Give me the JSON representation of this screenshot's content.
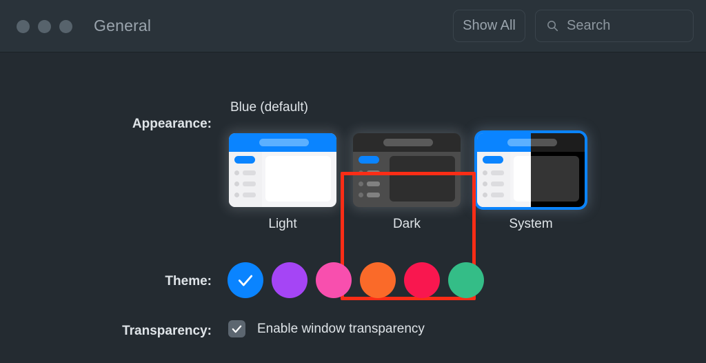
{
  "window": {
    "title": "General",
    "traffic_lights": [
      "close",
      "minimize",
      "zoom"
    ],
    "show_all_label": "Show All",
    "search_placeholder": "Search",
    "search_value": "",
    "background_color": "#242b31",
    "titlebar_color": "#2a333a"
  },
  "appearance": {
    "row_label": "Appearance:",
    "accent_caption": "Blue (default)",
    "selected": "System",
    "options": [
      {
        "id": "light",
        "label": "Light",
        "selected": false
      },
      {
        "id": "dark",
        "label": "Dark",
        "selected": false
      },
      {
        "id": "system",
        "label": "System",
        "selected": true
      }
    ]
  },
  "theme": {
    "row_label": "Theme:",
    "selected_index": 0,
    "swatches": [
      {
        "name": "blue",
        "color": "#0a84ff",
        "selected": true
      },
      {
        "name": "purple",
        "color": "#a545f5",
        "selected": false
      },
      {
        "name": "pink",
        "color": "#f84fae",
        "selected": false
      },
      {
        "name": "orange",
        "color": "#fa6a29",
        "selected": false
      },
      {
        "name": "crimson",
        "color": "#f9174f",
        "selected": false
      },
      {
        "name": "green",
        "color": "#34bd87",
        "selected": false
      }
    ]
  },
  "transparency": {
    "row_label": "Transparency:",
    "checkbox_label": "Enable window transparency",
    "checked": true
  },
  "annotation": {
    "target": "Dark",
    "color": "#fb2d16"
  },
  "icons": {
    "search": "search-icon",
    "checkmark": "checkmark-icon"
  }
}
